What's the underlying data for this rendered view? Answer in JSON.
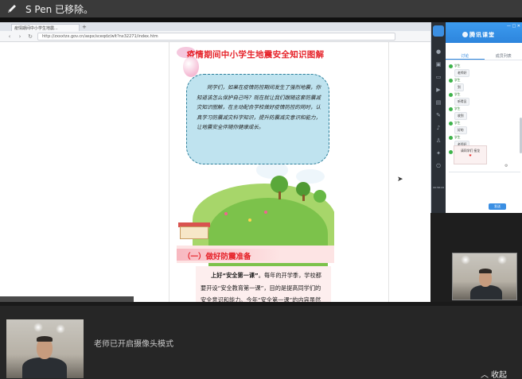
{
  "notification": {
    "text": "S Pen 已移除。"
  },
  "browser": {
    "tab_title": "疫情期间中小学生地震...",
    "url": "http://zxxxtzx.gov.cn/aspx/sceqdz/wlt?nx32271/index.htm"
  },
  "document": {
    "title": "疫情期间中小学生地震安全知识图解",
    "intro": "同学们，如果在疫情防控期间发生了强烈地震，你知道该怎么保护自己吗？现在就让我们跟随这套防震减灾知识图解，在主动配合学校做好疫情防控的同时，认真学习防震减灾科学知识，提升防震减灾意识和能力，让地震安全伴随你健康成长。",
    "section_title": "（一）做好防震准备",
    "para_lead": "上好“安全第一课”",
    "para_rest": "。每年的开学季，学校都要开设“安全教育第一课”，目的是提高同学们的安全意识和能力。今年“安全第一课”的内容虽然是疫情防控和公共卫生健康知识，但是我们更应注意的是，在这个疫情防控的特殊时期，学习"
  },
  "live": {
    "brand": "腾讯课堂",
    "tabs": [
      "讨论",
      "成员列表"
    ],
    "send_label": "发送",
    "time_text": "00:58:18",
    "card_text": "请同学们 接龙",
    "messages": [
      {
        "name": "学生",
        "text": "老师好"
      },
      {
        "name": "学生",
        "text": "到"
      },
      {
        "name": "学生",
        "text": "听得见"
      },
      {
        "name": "学生",
        "text": "收到"
      },
      {
        "name": "学生",
        "text": "好的"
      },
      {
        "name": "学生",
        "text": "老师好"
      },
      {
        "name": "学生",
        "text": "明白"
      }
    ]
  },
  "bottom": {
    "camera_status": "老师已开启摄像头模式",
    "collapse_label": "收起"
  },
  "colors": {
    "accent": "#2d85dd",
    "title_red": "#e6232a",
    "bubble": "#bfe3ef"
  }
}
